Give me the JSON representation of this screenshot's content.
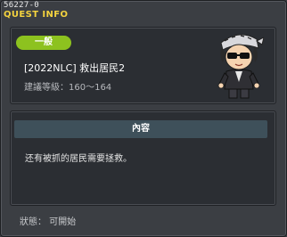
{
  "window": {
    "quest_id": "56227-0",
    "title": "QUEST INFO"
  },
  "quest": {
    "category": "一般",
    "name": "[2022NLC] 救出居民2",
    "recommended_level": "建議等級：160～164",
    "npc_icon": "npc-portrait"
  },
  "content": {
    "header": "內容",
    "description": "还有被抓的居民需要拯救。"
  },
  "status": {
    "text": "狀態： 可開始"
  },
  "colors": {
    "title": "#f3d23f",
    "badge": "#8dc21f",
    "content_header": "#3e505a"
  }
}
